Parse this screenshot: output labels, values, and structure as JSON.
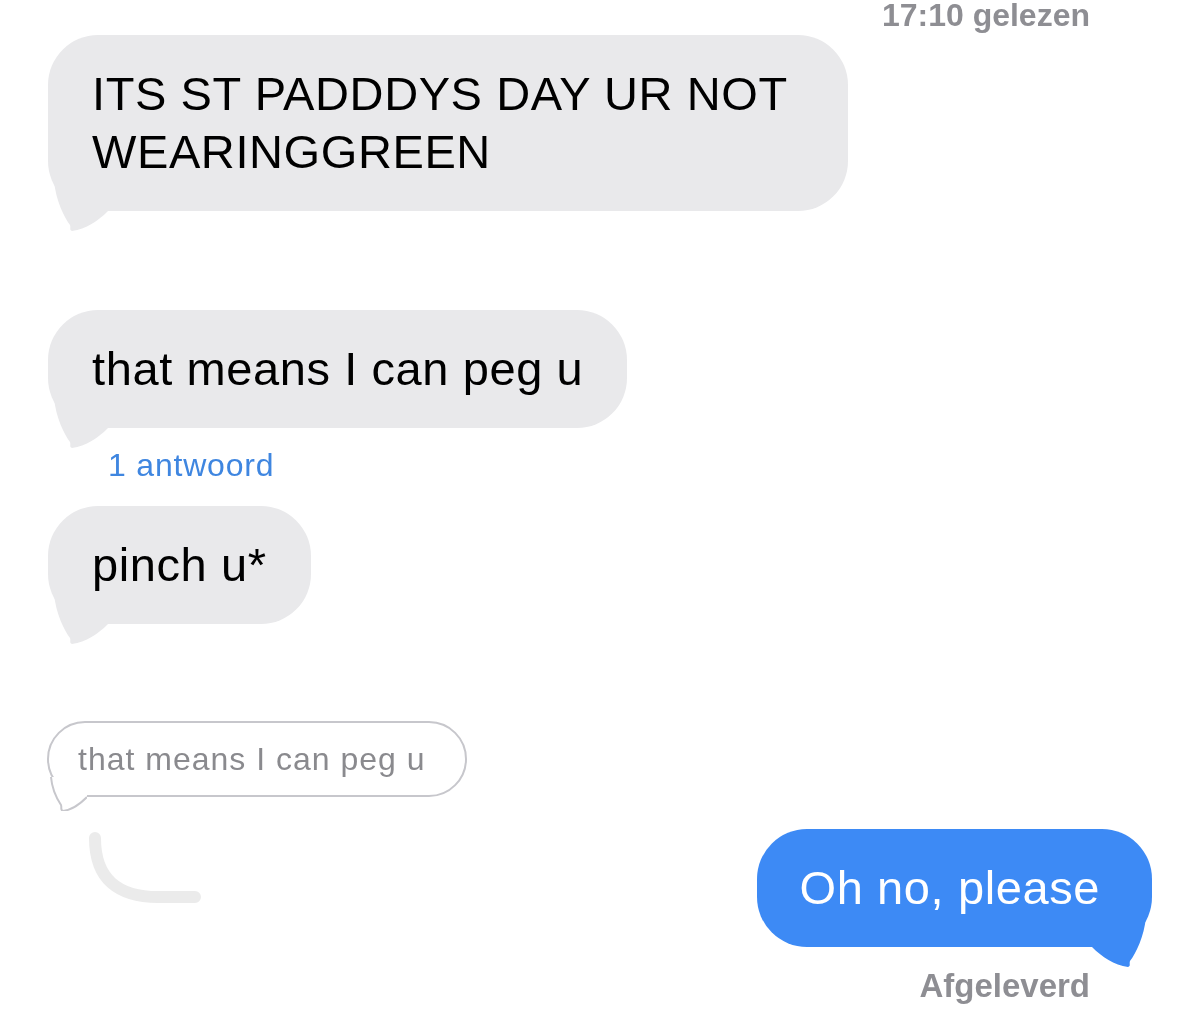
{
  "read_receipt": "17:10 gelezen",
  "messages": [
    {
      "kind": "received",
      "text": "ITS ST PADDDYS DAY UR NOT WEARINGGREEN"
    },
    {
      "kind": "received",
      "text": "that means I can peg u",
      "reply_link": "1 antwoord"
    },
    {
      "kind": "received",
      "text": "pinch u*"
    },
    {
      "kind": "quoted",
      "text": "that means I can peg u"
    },
    {
      "kind": "sent",
      "text": "Oh no, please",
      "status": "Afgeleverd"
    }
  ]
}
